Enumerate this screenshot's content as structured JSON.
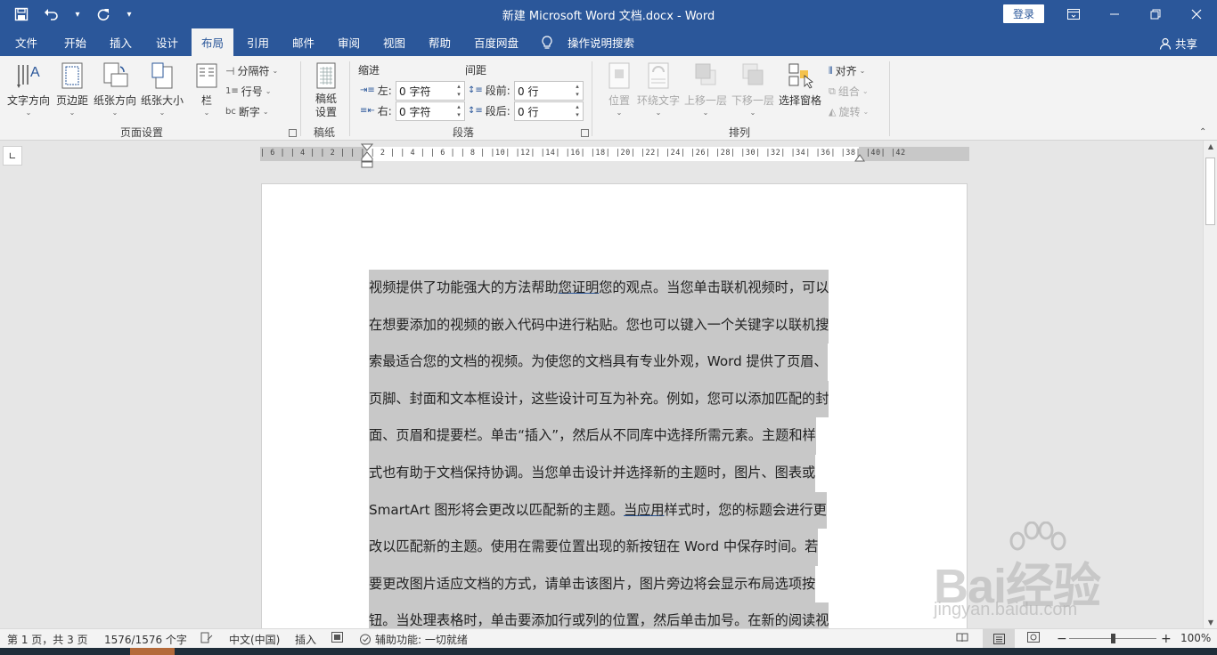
{
  "window": {
    "title": "新建 Microsoft Word 文档.docx  -  Word",
    "signin_label": "登录",
    "accent_color": "#2b579a"
  },
  "quick_access": {
    "save": "save-icon",
    "undo": "undo-icon",
    "redo": "redo-icon"
  },
  "menu": {
    "tabs": [
      "文件",
      "开始",
      "插入",
      "设计",
      "布局",
      "引用",
      "邮件",
      "审阅",
      "视图",
      "帮助",
      "百度网盘"
    ],
    "active_tab": "布局",
    "tell_me": "操作说明搜索",
    "share": "共享"
  },
  "ribbon": {
    "page_setup": {
      "label": "页面设置",
      "text_direction": "文字方向",
      "margins": "页边距",
      "orientation": "纸张方向",
      "size": "纸张大小",
      "columns": "栏",
      "breaks": "分隔符",
      "line_numbers": "行号",
      "hyphenation": "断字"
    },
    "manuscript": {
      "label": "稿纸",
      "button_line1": "稿纸",
      "button_line2": "设置"
    },
    "paragraph": {
      "label": "段落",
      "indent_title": "缩进",
      "spacing_title": "间距",
      "left_label": "左:",
      "left_value": "0 字符",
      "right_label": "右:",
      "right_value": "0 字符",
      "before_label": "段前:",
      "before_value": "0 行",
      "after_label": "段后:",
      "after_value": "0 行"
    },
    "arrange": {
      "label": "排列",
      "position": "位置",
      "wrap_text": "环绕文字",
      "bring_forward": "上移一层",
      "send_backward": "下移一层",
      "selection_pane": "选择窗格",
      "align": "对齐",
      "group": "组合",
      "rotate": "旋转"
    }
  },
  "ruler": {
    "numbers": "| 6 |   | 4 |   | 2 |   |   |   | 2 |   | 4 |   | 6 |   | 8 |   |10|   |12|   |14|   |16|   |18|   |20|   |22|   |24|   |26|   |28|   |30|   |32|   |34|   |36|   |38|   |40|   |42"
  },
  "document": {
    "lines": [
      {
        "before": "视频提供了功能强大的方法帮助",
        "sq": "您证明",
        "after": "您的观点。当您单击联机视频时，可以"
      },
      {
        "before": "在想要添加的视频的嵌入代码中进行粘贴。您也可以键入一个关键字以联机搜",
        "sq": "",
        "after": ""
      },
      {
        "before": "索最适合您的文档的视频。为使您的文档具有专业外观，Word 提供了页眉、",
        "sq": "",
        "after": ""
      },
      {
        "before": "页脚、封面和文本框设计，这些设计可互为补充。例如，您可以添加匹配的封",
        "sq": "",
        "after": ""
      },
      {
        "before": "面、页眉和提要栏。单击“插入”，然后从不同库中选择所需元素。主题和样",
        "sq": "",
        "after": ""
      },
      {
        "before": "式也有助于文档保持协调。当您单击设计并选择新的主题时，图片、图表或",
        "sq": "",
        "after": ""
      },
      {
        "before": "SmartArt 图形将会更改以匹配新的主题。",
        "sq": "当应用",
        "after": "样式时，您的标题会进行更"
      },
      {
        "before": "改以匹配新的主题。使用在需要位置出现的新按钮在 Word 中保存时间。若",
        "sq": "",
        "after": ""
      },
      {
        "before": "要更改图片适应文档的方式，请单击该图片，图片旁边将会显示布局选项按",
        "sq": "",
        "after": ""
      },
      {
        "before": "钮。当处理表格时，单击要添加行或列的位置，然后单击加号。在新的阅读视",
        "sq": "",
        "after": ""
      }
    ]
  },
  "watermark": {
    "brand": "Bai经验",
    "url": "jingyan.baidu.com"
  },
  "status": {
    "page": "第 1 页，共 3 页",
    "words": "1576/1576 个字",
    "language": "中文(中国)",
    "mode": "插入",
    "accessibility": "辅助功能: 一切就绪",
    "zoom": "100%"
  }
}
